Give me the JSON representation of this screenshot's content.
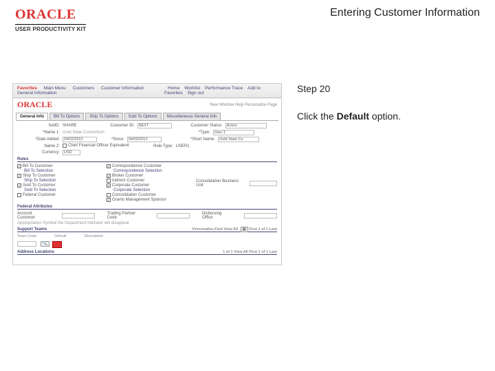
{
  "header": {
    "brand": "ORACLE",
    "upk": "USER PRODUCTIVITY KIT",
    "doc_title": "Entering Customer Information"
  },
  "instructions": {
    "step_label": "Step 20",
    "line_prefix": "Click the ",
    "line_bold": "Default",
    "line_suffix": " option."
  },
  "shot": {
    "brand": "ORACLE",
    "topmenu": [
      "Favorites",
      "Main Menu",
      "Customers",
      "Customer Information",
      "General Information"
    ],
    "toplinks": [
      "Home",
      "Worklist",
      "Performance Trace",
      "Add to Favorites",
      "Sign out"
    ],
    "crumbs": "New Window   Help   Personalize Page",
    "tabs": [
      "General Info",
      "Bill To Options",
      "Ship To Options",
      "Sold To Options",
      "Miscellaneous General Info"
    ],
    "row1": {
      "setid_label": "SetID:",
      "setid_val": "SHARE",
      "custid_label": "Customer ID:",
      "custid_val": "NEXT",
      "custstatus_label": "Customer Status:",
      "custstatus_val": "Active"
    },
    "row2": {
      "name_label": "*Name 1:",
      "name_val": "Gold State Consortium",
      "type_label": "*Type:",
      "type_val": "User 1"
    },
    "row3": {
      "date_label": "*Date Added:",
      "date_val": "04/02/2012",
      "since_label": "*Since:",
      "since_val": "04/02/2012",
      "short_label": "*Short Name:",
      "short_val": "Gold State Co"
    },
    "row4": {
      "name2_label": "Name 2:",
      "cfo_label": "Chief Financial Officer Equivalent",
      "role_label": "Role Type:",
      "role_val": "USER1"
    },
    "row5": {
      "curr_label": "Currency:",
      "curr_val": "USD"
    },
    "roles_section": "Roles",
    "roles_col1": [
      {
        "checked": true,
        "label": "Bill To Customer"
      },
      {
        "checked": false,
        "label": "Bill To Selection"
      },
      {
        "checked": true,
        "label": "Ship To Customer"
      },
      {
        "checked": false,
        "label": "Ship To Selection"
      },
      {
        "checked": true,
        "label": "Sold To Customer"
      },
      {
        "checked": false,
        "label": "Sold To Selection"
      },
      {
        "checked": false,
        "label": "Federal Customer"
      }
    ],
    "roles_col2": [
      {
        "checked": true,
        "label": "Correspondence Customer"
      },
      {
        "checked": false,
        "label": "Correspondence Selection"
      },
      {
        "checked": true,
        "label": "Broker Customer"
      },
      {
        "checked": false,
        "label": "Indirect Customer"
      },
      {
        "checked": true,
        "label": "Corporate Customer"
      },
      {
        "checked": false,
        "label": "Corporate Selection"
      },
      {
        "checked": false,
        "label": "Consolidation Customer"
      },
      {
        "checked": true,
        "label": "Grants Management Sponsor"
      }
    ],
    "cons_unit": "Consolidation Business Unit",
    "fed_section": "Federal Attributes",
    "fed_labels": [
      "Account Customer",
      "Trading Partner Code",
      "Disbursing Office"
    ],
    "fed_note": "Appropriation Symbol the Department Indicator will disappear",
    "supp_section": "Support Teams",
    "supp_cols": [
      "Team Code",
      "Default",
      "Description"
    ],
    "supp_pager1": "Personalize   Find   View All",
    "supp_pager2": "First  1 of 1  Last",
    "addr_section": "Address Locations",
    "addr_pager": " 1 of 1  View All   First  1 of 1  Last"
  }
}
